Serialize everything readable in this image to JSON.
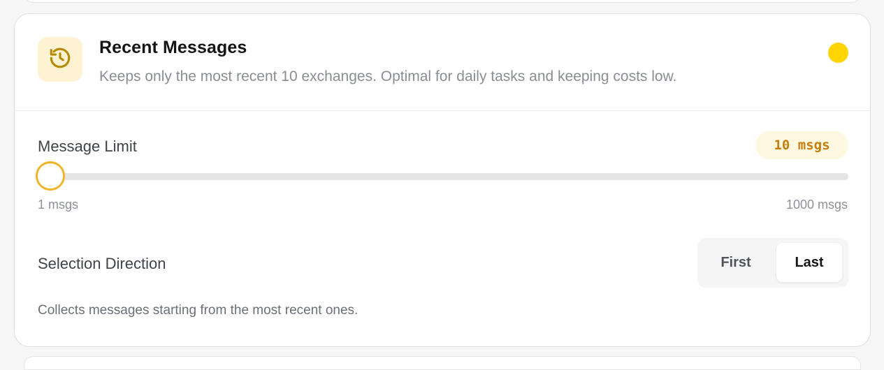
{
  "card": {
    "title": "Recent Messages",
    "description": "Keeps only the most recent 10 exchanges. Optimal for daily tasks and keeping costs low.",
    "icon": "history-clock-icon",
    "status_color": "#ffd500"
  },
  "message_limit": {
    "label": "Message Limit",
    "value_display": "10 msgs",
    "value": 10,
    "min": 1,
    "max": 1000,
    "min_label": "1 msgs",
    "max_label": "1000 msgs",
    "accent_color": "#f0b429"
  },
  "selection_direction": {
    "label": "Selection Direction",
    "options": [
      "First",
      "Last"
    ],
    "selected": "Last",
    "help_text": "Collects messages starting from the most recent ones."
  }
}
